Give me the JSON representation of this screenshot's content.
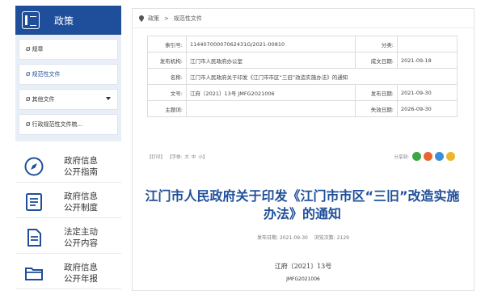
{
  "section": {
    "title": "政策"
  },
  "menu": {
    "items": [
      {
        "icon": "Ø",
        "label": "规章"
      },
      {
        "icon": "Ø",
        "label": "规范性文件"
      },
      {
        "icon": "Ø",
        "label": "其他文件"
      },
      {
        "icon": "Ø",
        "label": "行政规范性文件梳..."
      }
    ]
  },
  "info": [
    {
      "line1": "政府信息",
      "line2": "公开指南"
    },
    {
      "line1": "政府信息",
      "line2": "公开制度"
    },
    {
      "line1": "法定主动",
      "line2": "公开内容"
    },
    {
      "line1": "政府信息",
      "line2": "公开年报"
    }
  ],
  "breadcrumb": {
    "home": "政策",
    "sep": ">",
    "current": "规范性文件"
  },
  "meta": {
    "k_index": "索引号:",
    "v_index": "11440700007062431G/2021-00810",
    "k_category": "分类:",
    "v_category": "",
    "k_issuer": "发布机构:",
    "v_issuer": "江门市人民政府办公室",
    "k_made": "成文日期:",
    "v_made": "2021-09-18",
    "k_name": "名称:",
    "v_name": "江门市人民政府关于印发《江门市市区“三旧”改造实施办法》的通知",
    "k_docno": "文号:",
    "v_docno": "江府〔2021〕13号 JMFG2021006",
    "k_pubdate": "发布日期:",
    "v_pubdate": "2021-09-30",
    "k_subject": "主题词:",
    "v_subject": "",
    "k_expiry": "失效日期:",
    "v_expiry": "2026-09-30"
  },
  "toolbar": {
    "print": "【打印】",
    "font": "【字体:",
    "big": "大",
    "mid": "中",
    "small": "小",
    "close": "】",
    "share": "分享到:"
  },
  "article": {
    "title": "江门市人民政府关于印发《江门市市区“三旧”改造实施办法》的通知",
    "pub_label": "发布日期:",
    "pub_date": "2021-09-30",
    "views_label": "浏览次数:",
    "views": "2129",
    "docno": "江府〔2021〕13号",
    "jmfg": "JMFG2021006"
  },
  "colors": {
    "primary": "#1f4f9a",
    "wechat": "#3aa644",
    "weibo": "#e6662e",
    "qq": "#3a8fd8",
    "qzone": "#f0b428"
  }
}
